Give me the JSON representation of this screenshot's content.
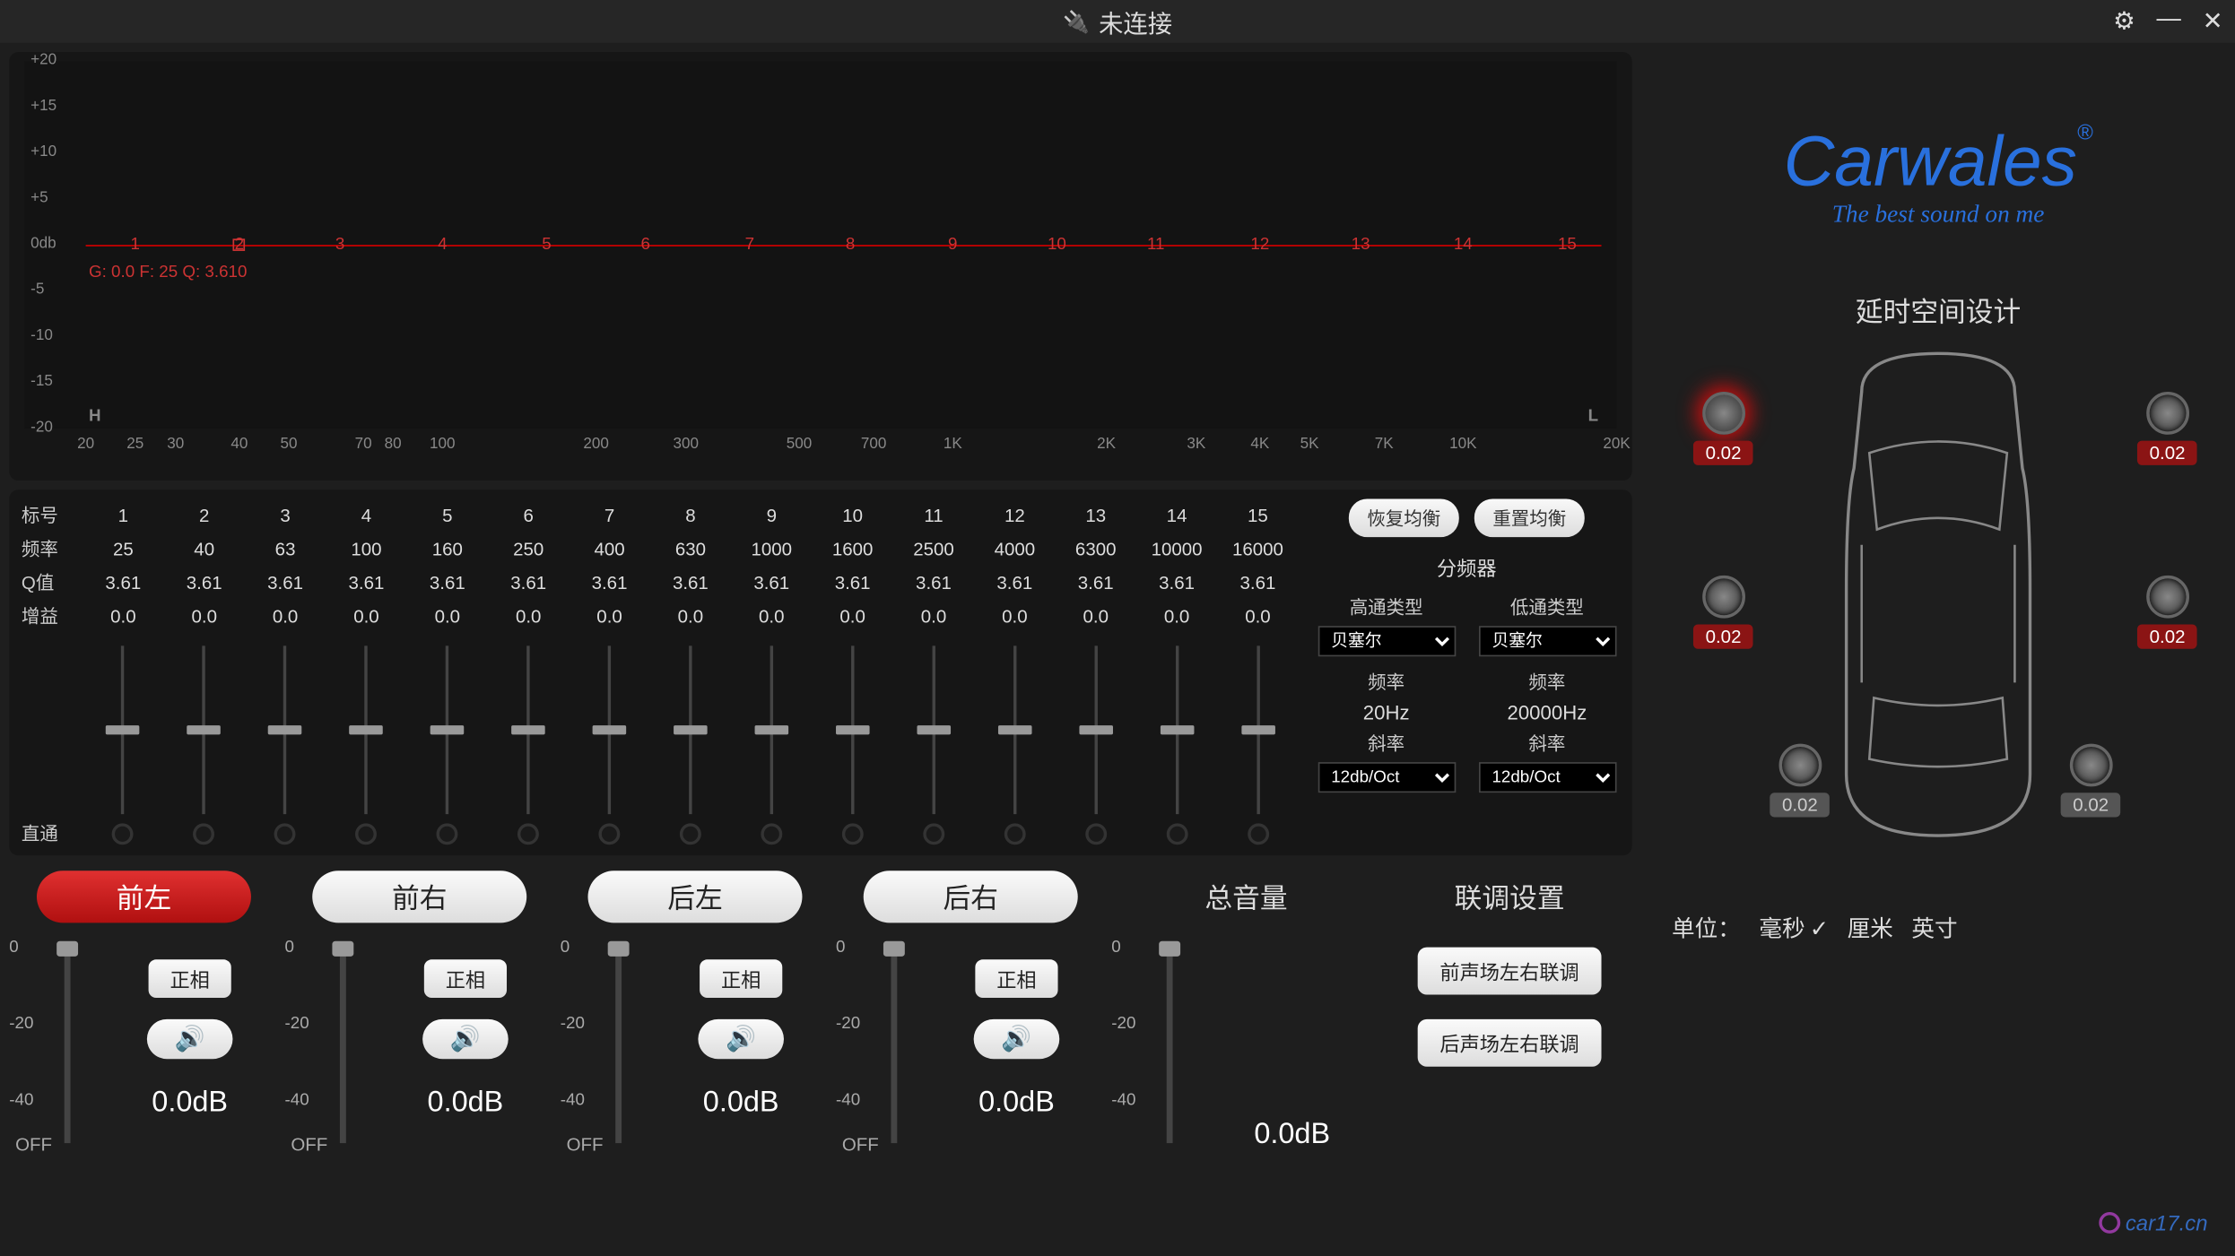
{
  "title": "未连接",
  "titlebar_icon": "disconnect-icon",
  "logo": {
    "name": "Carwales",
    "reg": "®",
    "tagline": "The best sound on me"
  },
  "eq_graph": {
    "y_ticks": [
      "+20",
      "+15",
      "+10",
      "+5",
      "0db",
      "-5",
      "-10",
      "-15",
      "-20"
    ],
    "x_ticks": [
      "20",
      "25",
      "30",
      "40",
      "50",
      "70",
      "80",
      "100",
      "200",
      "300",
      "500",
      "700",
      "1K",
      "2K",
      "3K",
      "4K",
      "5K",
      "7K",
      "10K",
      "20K"
    ],
    "band_numbers": [
      "1",
      "2",
      "3",
      "4",
      "5",
      "6",
      "7",
      "8",
      "9",
      "10",
      "11",
      "12",
      "13",
      "14",
      "15"
    ],
    "selected_band": 2,
    "h_label": "H",
    "l_label": "L",
    "readout": "G: 0.0  F: 25  Q: 3.610"
  },
  "eq_table": {
    "row_labels": {
      "index": "标号",
      "freq": "频率",
      "q": "Q值",
      "gain": "增益"
    },
    "bands": [
      {
        "idx": "1",
        "freq": "25",
        "q": "3.61",
        "gain": "0.0"
      },
      {
        "idx": "2",
        "freq": "40",
        "q": "3.61",
        "gain": "0.0"
      },
      {
        "idx": "3",
        "freq": "63",
        "q": "3.61",
        "gain": "0.0"
      },
      {
        "idx": "4",
        "freq": "100",
        "q": "3.61",
        "gain": "0.0"
      },
      {
        "idx": "5",
        "freq": "160",
        "q": "3.61",
        "gain": "0.0"
      },
      {
        "idx": "6",
        "freq": "250",
        "q": "3.61",
        "gain": "0.0"
      },
      {
        "idx": "7",
        "freq": "400",
        "q": "3.61",
        "gain": "0.0"
      },
      {
        "idx": "8",
        "freq": "630",
        "q": "3.61",
        "gain": "0.0"
      },
      {
        "idx": "9",
        "freq": "1000",
        "q": "3.61",
        "gain": "0.0"
      },
      {
        "idx": "10",
        "freq": "1600",
        "q": "3.61",
        "gain": "0.0"
      },
      {
        "idx": "11",
        "freq": "2500",
        "q": "3.61",
        "gain": "0.0"
      },
      {
        "idx": "12",
        "freq": "4000",
        "q": "3.61",
        "gain": "0.0"
      },
      {
        "idx": "13",
        "freq": "6300",
        "q": "3.61",
        "gain": "0.0"
      },
      {
        "idx": "14",
        "freq": "10000",
        "q": "3.61",
        "gain": "0.0"
      },
      {
        "idx": "15",
        "freq": "16000",
        "q": "3.61",
        "gain": "0.0"
      }
    ],
    "passthrough_label": "直通"
  },
  "eq_buttons": {
    "restore": "恢复均衡",
    "reset": "重置均衡"
  },
  "crossover": {
    "title": "分频器",
    "hp": {
      "type_label": "高通类型",
      "type_value": "贝塞尔",
      "freq_label": "频率",
      "freq_value": "20Hz",
      "slope_label": "斜率",
      "slope_value": "12db/Oct"
    },
    "lp": {
      "type_label": "低通类型",
      "type_value": "贝塞尔",
      "freq_label": "频率",
      "freq_value": "20000Hz",
      "slope_label": "斜率",
      "slope_value": "12db/Oct"
    }
  },
  "channels": {
    "scale": [
      "0",
      "-20",
      "-40",
      "OFF"
    ],
    "list": [
      {
        "name": "前左",
        "active": true,
        "phase": "正相",
        "db": "0.0dB"
      },
      {
        "name": "前右",
        "active": false,
        "phase": "正相",
        "db": "0.0dB"
      },
      {
        "name": "后左",
        "active": false,
        "phase": "正相",
        "db": "0.0dB"
      },
      {
        "name": "后右",
        "active": false,
        "phase": "正相",
        "db": "0.0dB"
      }
    ],
    "master": {
      "label": "总音量",
      "db": "0.0dB"
    }
  },
  "link": {
    "title": "联调设置",
    "front": "前声场左右联调",
    "rear": "后声场左右联调"
  },
  "delay": {
    "title": "延时空间设计",
    "speakers": [
      {
        "pos": "fl",
        "val": "0.02",
        "active": true,
        "red": true
      },
      {
        "pos": "fr",
        "val": "0.02",
        "active": false,
        "red": true
      },
      {
        "pos": "ml",
        "val": "0.02",
        "active": false,
        "red": true
      },
      {
        "pos": "mr",
        "val": "0.02",
        "active": false,
        "red": true
      },
      {
        "pos": "rl",
        "val": "0.02",
        "active": false,
        "red": false
      },
      {
        "pos": "rr",
        "val": "0.02",
        "active": false,
        "red": false
      }
    ]
  },
  "units": {
    "label": "单位：",
    "ms": "毫秒",
    "cm": "厘米",
    "inch": "英寸",
    "selected": "ms"
  },
  "watermark": "car17.cn"
}
